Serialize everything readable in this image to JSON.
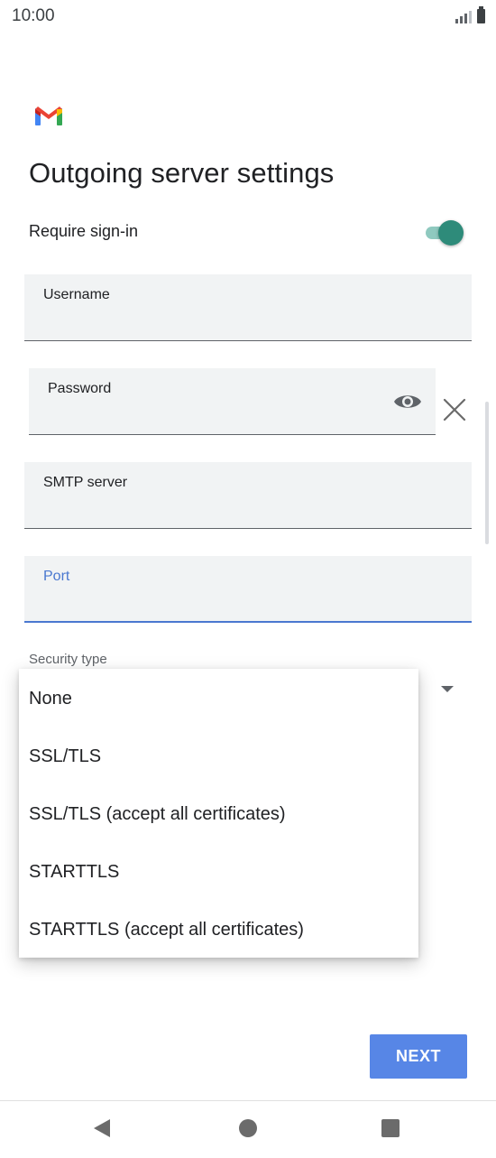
{
  "status_bar": {
    "time": "10:00"
  },
  "header": {
    "title": "Outgoing server settings"
  },
  "require_signin": {
    "label": "Require sign-in",
    "enabled": true
  },
  "fields": {
    "username": {
      "label": "Username",
      "value": ""
    },
    "password": {
      "label": "Password",
      "value": ""
    },
    "smtp_server": {
      "label": "SMTP server",
      "value": ""
    },
    "port": {
      "label": "Port",
      "value": ""
    }
  },
  "security": {
    "label": "Security type",
    "options": [
      "None",
      "SSL/TLS",
      "SSL/TLS (accept all certificates)",
      "STARTTLS",
      "STARTTLS (accept all certificates)"
    ]
  },
  "actions": {
    "next_label": "NEXT"
  },
  "colors": {
    "accent": "#4a78d0",
    "toggle_on": "#2e8b7a",
    "button": "#5786e6"
  },
  "icons": [
    "gmail-logo",
    "eye-icon",
    "close-icon",
    "dropdown-arrow-icon",
    "back-icon",
    "home-icon",
    "recents-icon"
  ]
}
